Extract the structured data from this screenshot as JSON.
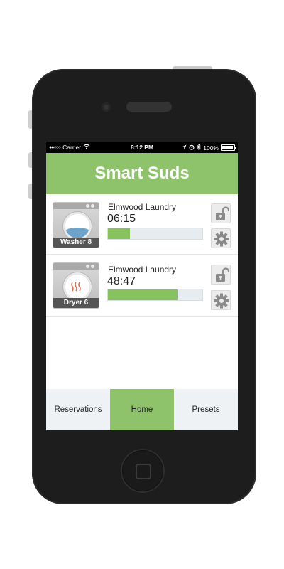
{
  "status_bar": {
    "signal": "●●○○○",
    "carrier": "Carrier",
    "time": "8:12 PM",
    "battery": "100%",
    "icons": [
      "wifi-icon",
      "location-icon",
      "alarm-icon",
      "bluetooth-icon",
      "battery-icon"
    ]
  },
  "app": {
    "title": "Smart Suds"
  },
  "machines": [
    {
      "name": "Washer 8",
      "type": "washer",
      "location": "Elmwood Laundry",
      "time_remaining": "06:15",
      "progress_fraction": 0.23,
      "icons": [
        "unlock-icon",
        "gear-icon"
      ]
    },
    {
      "name": "Dryer 6",
      "type": "dryer",
      "location": "Elmwood Laundry",
      "time_remaining": "48:47",
      "progress_fraction": 0.74,
      "icons": [
        "unlock-icon",
        "gear-icon"
      ]
    }
  ],
  "tabs": [
    {
      "label": "Reservations",
      "active": false
    },
    {
      "label": "Home",
      "active": true
    },
    {
      "label": "Presets",
      "active": false
    }
  ],
  "colors": {
    "accent_green": "#8ec36c",
    "progress_green": "#86c35e",
    "progress_track": "#e6ecef",
    "tab_inactive": "#eef2f4",
    "phone_body": "#1d1d1d"
  }
}
